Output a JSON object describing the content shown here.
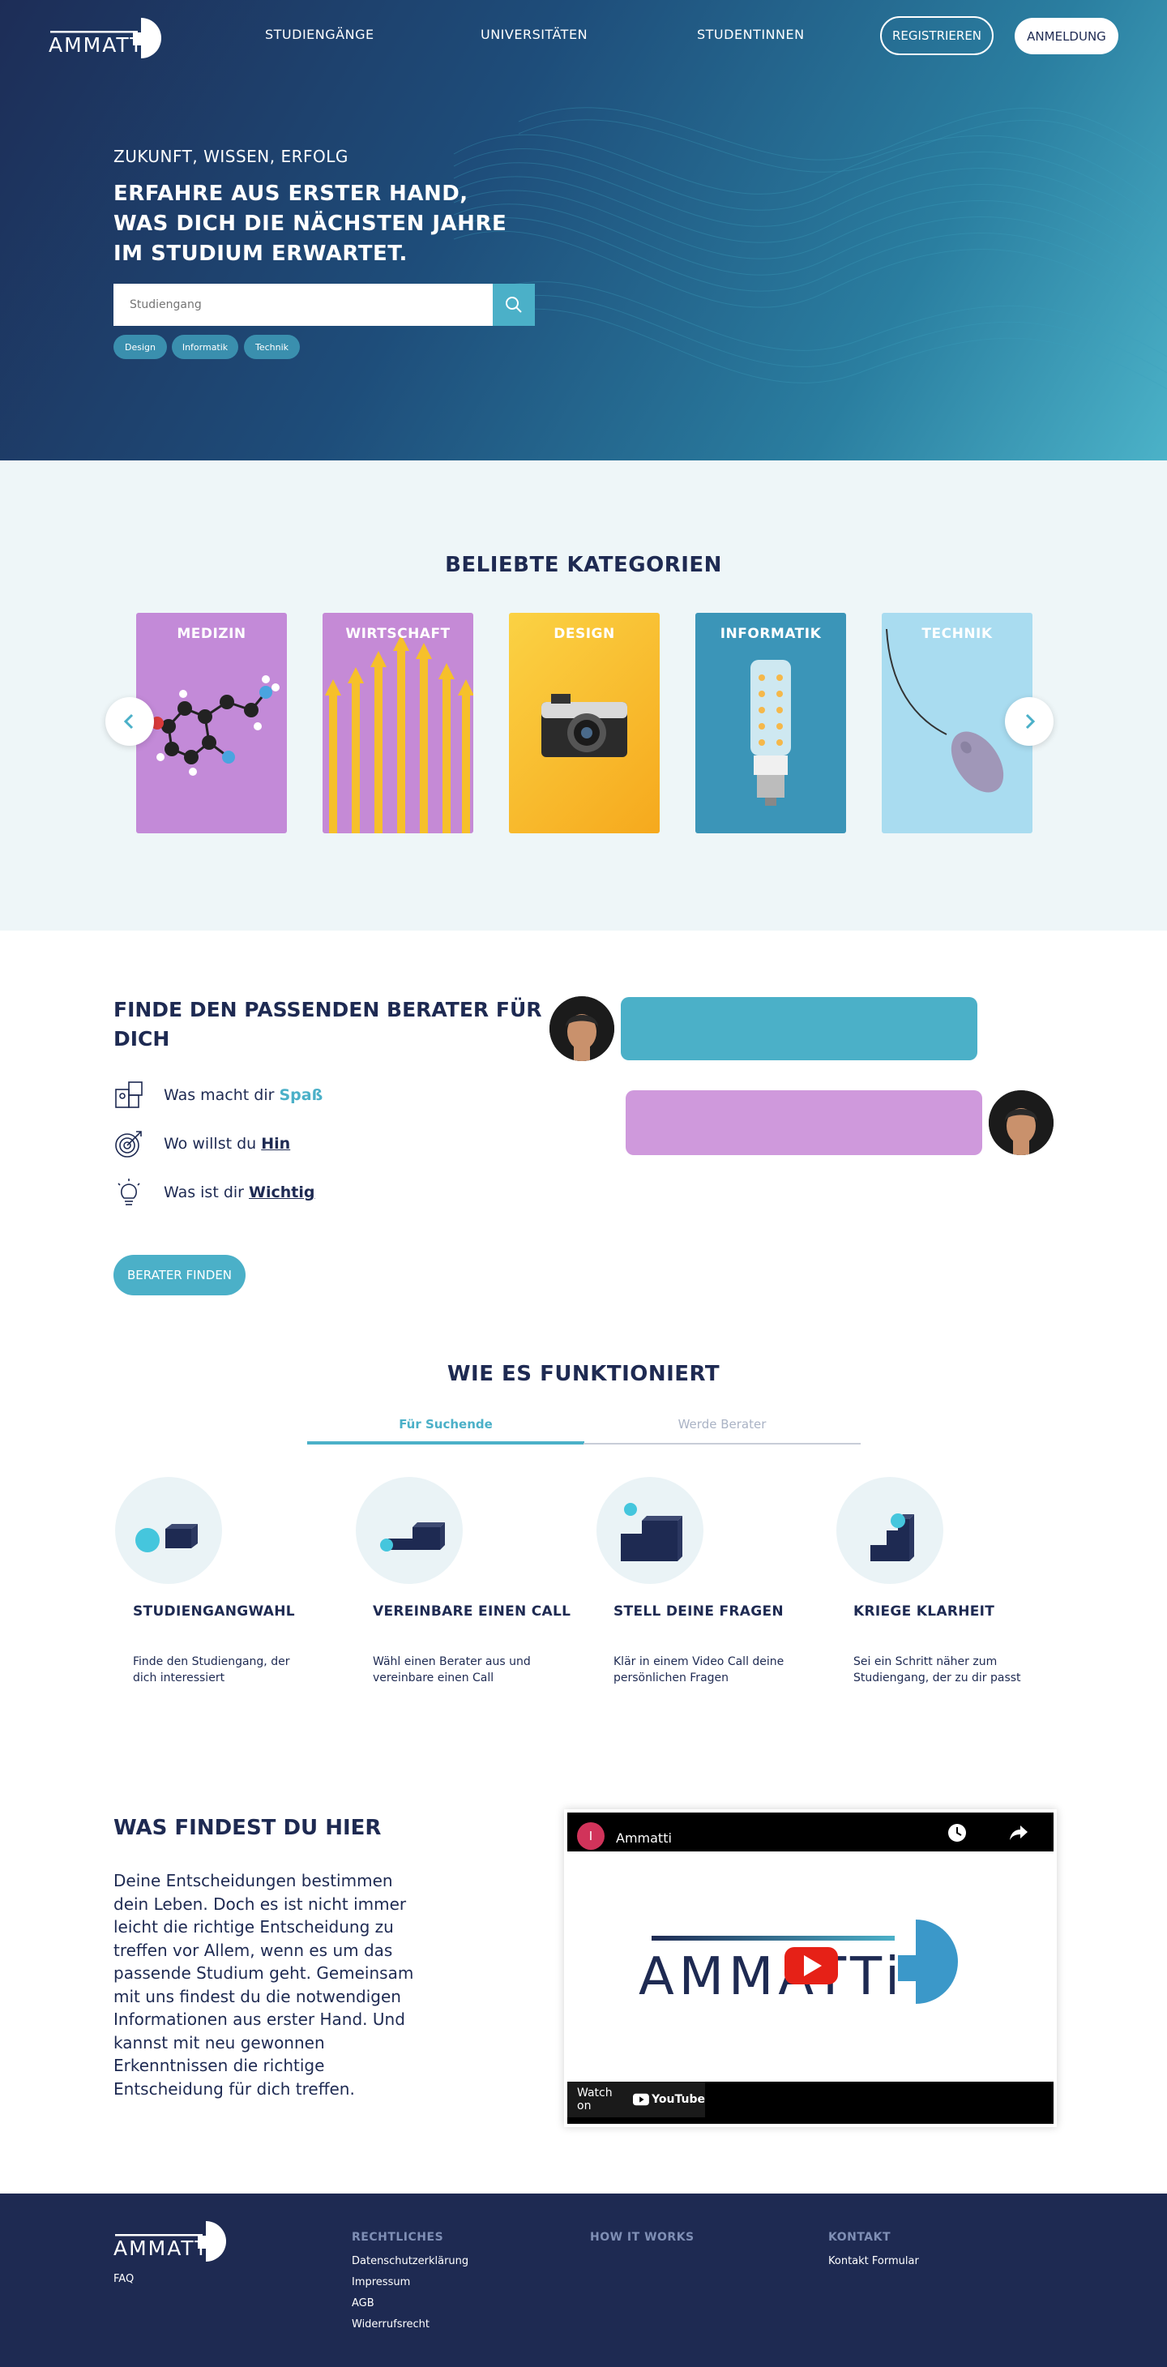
{
  "brand": {
    "name": "AMMATTi"
  },
  "nav": {
    "links": [
      "STUDIENGÄNGE",
      "UNIVERSITÄTEN",
      "STUDENTINNEN"
    ],
    "register": "REGISTRIEREN",
    "login": "ANMELDUNG"
  },
  "hero": {
    "kicker": "ZUKUNFT, WISSEN, ERFOLG",
    "title": "ERFAHRE AUS ERSTER HAND, WAS DICH DIE NÄCHSTEN JAHRE IM STUDIUM ERWARTET.",
    "search_placeholder": "Studiengang",
    "tags": [
      "Design",
      "Informatik",
      "Technik"
    ]
  },
  "categories": {
    "title": "BELIEBTE KATEGORIEN",
    "items": [
      {
        "label": "MEDIZIN",
        "color": "#c38ad8"
      },
      {
        "label": "WIRTSCHAFT",
        "color": "#c58ad6"
      },
      {
        "label": "DESIGN",
        "color": "#f8b833"
      },
      {
        "label": "INFORMATIK",
        "color": "#3b95b8"
      },
      {
        "label": "TECHNIK",
        "color": "#a9dcf0"
      }
    ]
  },
  "advisor": {
    "title": "FINDE DEN PASSENDEN BERATER FÜR DICH",
    "questions": [
      {
        "pre": "Was macht dir ",
        "highlight": "Spaß",
        "icon": "puzzle-icon"
      },
      {
        "pre": "Wo willst du ",
        "highlight": "Hin",
        "icon": "target-icon"
      },
      {
        "pre": "Was ist dir ",
        "highlight": "Wichtig",
        "icon": "lightbulb-icon"
      }
    ],
    "button": "BERATER FINDEN",
    "bubble_colors": {
      "first": "#4bb0c8",
      "second": "#cf99dc"
    }
  },
  "how": {
    "title": "WIE ES FUNKTIONIERT",
    "tabs": [
      "Für Suchende",
      "Werde Berater"
    ],
    "steps": [
      {
        "title": "STUDIENGANGWAHL",
        "desc": "Finde den Studiengang, der dich interessiert"
      },
      {
        "title": "VEREINBARE EINEN CALL",
        "desc": "Wähl einen Berater aus und vereinbare einen Call"
      },
      {
        "title": "STELL DEINE FRAGEN",
        "desc": "Klär in einem Video Call deine persönlichen Fragen"
      },
      {
        "title": "KRIEGE KLARHEIT",
        "desc": "Sei ein Schritt näher zum Studiengang, der zu dir passt"
      }
    ]
  },
  "what": {
    "title": "WAS FINDEST DU HIER",
    "text": "Deine Entscheidungen bestimmen dein Leben. Doch es ist nicht immer leicht die richtige Entscheidung zu treffen vor Allem, wenn es um das passende Studium geht. Gemeinsam mit uns findest du die notwendigen Informationen aus erster Hand. Und kannst mit neu gewonnen Erkenntnissen die richtige Entscheidung für dich treffen.",
    "video": {
      "channel_initial": "I",
      "title": "Ammatti",
      "logo_text": "AMMATTi",
      "watch_on": "Watch on",
      "youtube": "YouTube"
    }
  },
  "footer": {
    "faq": "FAQ",
    "columns": [
      {
        "head": "RECHTLICHES",
        "links": [
          "Datenschutzerklärung",
          "Impressum",
          "AGB",
          "Widerrufsrecht"
        ]
      },
      {
        "head": "HOW IT WORKS",
        "links": []
      },
      {
        "head": "KONTAKT",
        "links": [
          "Kontakt Formular"
        ]
      }
    ]
  }
}
